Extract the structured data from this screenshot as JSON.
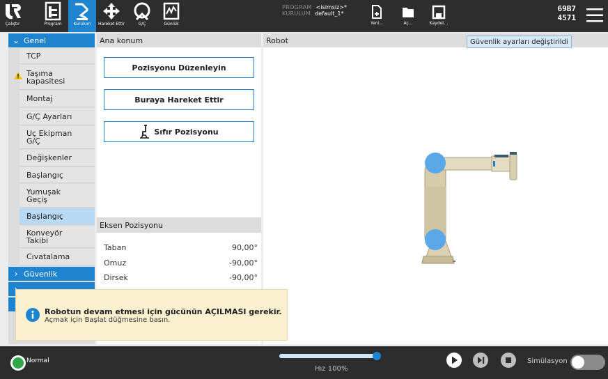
{
  "topbar": {
    "nav": [
      {
        "label": "Çalıştır",
        "icon": "logo-icon"
      },
      {
        "label": "Program",
        "icon": "program-icon"
      },
      {
        "label": "Kurulum",
        "icon": "installation-icon",
        "active": true
      },
      {
        "label": "Hareket Ettir",
        "icon": "move-icon"
      },
      {
        "label": "G/Ç",
        "icon": "io-icon"
      },
      {
        "label": "Günlük",
        "icon": "log-icon"
      }
    ],
    "program_key": "PROGRAM",
    "program_value": "<isimsiz>*",
    "installation_key": "KURULUM",
    "installation_value": "default_1*",
    "file_buttons": [
      {
        "label": "Yeni...",
        "icon": "new-file-icon"
      },
      {
        "label": "Aç...",
        "icon": "open-folder-icon"
      },
      {
        "label": "Kaydet...",
        "icon": "save-icon"
      }
    ],
    "serial_line1": "69B7",
    "serial_line2": "4571"
  },
  "tooltip": "Güvenlik ayarları değiştirildi",
  "sidebar": {
    "section_general": "Genel",
    "items": [
      {
        "label": "TCP"
      },
      {
        "label": "Taşıma kapasitesi",
        "warning": true
      },
      {
        "label": "Montaj"
      },
      {
        "label": "G/Ç Ayarları"
      },
      {
        "label": "Uç Ekipman G/Ç"
      },
      {
        "label": "Değişkenler"
      },
      {
        "label": "Başlangıç"
      },
      {
        "label": "Yumuşak Geçiş"
      },
      {
        "label": "Başlangıç",
        "active": true
      },
      {
        "label": "Konveyör Takibi"
      },
      {
        "label": "Cıvatalama"
      }
    ],
    "section_safety": "Güvenlik"
  },
  "home_panel": {
    "title": "Ana konum",
    "btn_edit": "Pozisyonu Düzenleyin",
    "btn_move": "Buraya Hareket Ettir",
    "btn_zero": "Sıfır Pozisyonu"
  },
  "joint_panel": {
    "title": "Eksen Pozisyonu",
    "joints": [
      {
        "name": "Taban",
        "value": "90,00°"
      },
      {
        "name": "Omuz",
        "value": "-90,00°"
      },
      {
        "name": "Dirsek",
        "value": "-90,00°"
      }
    ]
  },
  "robot_panel": {
    "title": "Robot"
  },
  "notification": {
    "title": "Robotun devam etmesi için gücünün AÇILMASI gerekir.",
    "body": "Açmak için Başlat düğmesine basın."
  },
  "bottombar": {
    "status": "Normal",
    "speed_label": "Hız 100%",
    "speed_value": 1.0,
    "simulation_label": "Simülasyon"
  },
  "colors": {
    "accent": "#1e84d0",
    "dark_bar": "#2d2d2d",
    "status_green": "#2ea84a",
    "notification_bg": "#faefcf"
  }
}
